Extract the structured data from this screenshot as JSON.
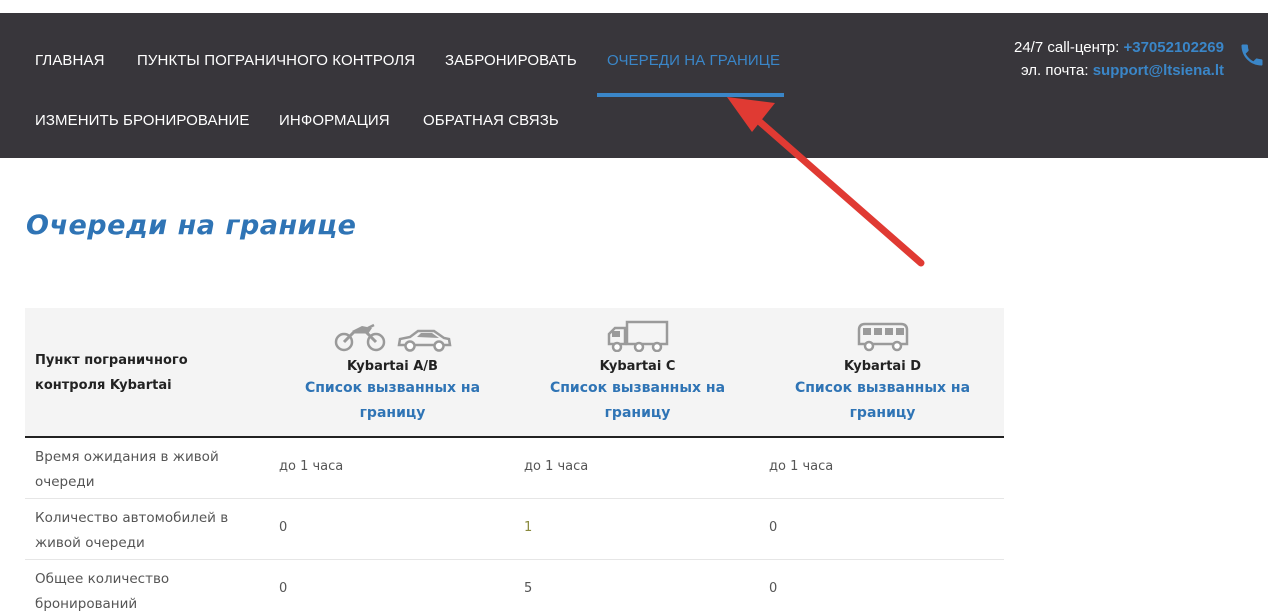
{
  "nav": {
    "items": [
      {
        "label": "ГЛАВНАЯ"
      },
      {
        "label": "ПУНКТЫ ПОГРАНИЧНОГО КОНТРОЛЯ"
      },
      {
        "label": "ЗАБРОНИРОВАТЬ"
      },
      {
        "label": "ОЧЕРЕДИ НА ГРАНИЦЕ",
        "active": true
      },
      {
        "label": "ИЗМЕНИТЬ БРОНИРОВАНИЕ"
      },
      {
        "label": "ИНФОРМАЦИЯ"
      },
      {
        "label": "ОБРАТНАЯ СВЯЗЬ"
      }
    ]
  },
  "contact": {
    "call_label": "24/7 call-центр: ",
    "phone": "+37052102269",
    "email_label": "эл. почта: ",
    "email": "support@ltsiena.lt"
  },
  "page": {
    "title": "Очереди на границе"
  },
  "table": {
    "header_first": "Пункт пограничного контроля Kybartai",
    "columns": [
      {
        "name": "Kybartai A/B",
        "link": "Список вызванных на границу",
        "icons": [
          "motorcycle-icon",
          "car-icon"
        ]
      },
      {
        "name": "Kybartai C",
        "link": "Список вызванных на границу",
        "icons": [
          "truck-icon"
        ]
      },
      {
        "name": "Kybartai D",
        "link": "Список вызванных на границу",
        "icons": [
          "bus-icon"
        ]
      }
    ],
    "rows": [
      {
        "label": "Время ожидания в живой очереди",
        "values": [
          "до 1 часа",
          "до 1 часа",
          "до 1 часа"
        ]
      },
      {
        "label": "Количество автомобилей в живой очереди",
        "values": [
          "0",
          "1",
          "0"
        ]
      },
      {
        "label": "Общее количество бронирований",
        "values": [
          "0",
          "5",
          "0"
        ]
      }
    ]
  },
  "colors": {
    "nav_bg": "#38363b",
    "accent": "#3a86c8",
    "title": "#2f74b5",
    "arrow": "#e03a33"
  }
}
